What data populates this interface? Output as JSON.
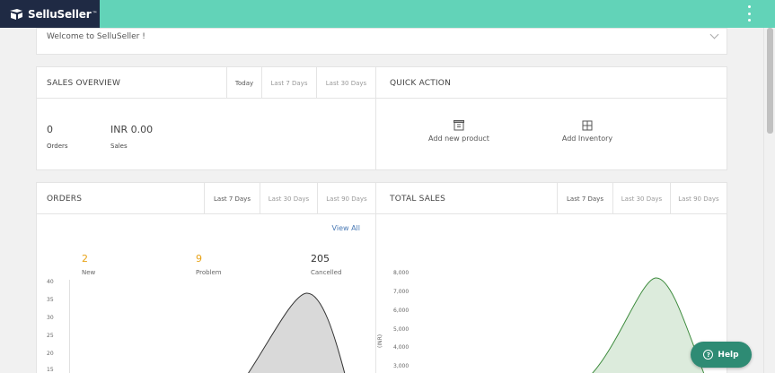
{
  "brand": {
    "name": "SelluSeller",
    "mark": "™"
  },
  "welcome": {
    "text": "Welcome to SelluSeller !"
  },
  "sales_overview": {
    "title": "SALES OVERVIEW",
    "tabs": [
      "Today",
      "Last 7 Days",
      "Last 30 Days"
    ],
    "active_tab": "Today",
    "orders": {
      "value": "0",
      "label": "Orders"
    },
    "sales": {
      "value": "INR 0.00",
      "label": "Sales"
    }
  },
  "quick_action": {
    "title": "QUICK ACTION",
    "items": [
      {
        "label": "Add new product",
        "icon": "product-box-icon"
      },
      {
        "label": "Add Inventory",
        "icon": "inventory-grid-icon"
      }
    ]
  },
  "orders": {
    "title": "ORDERS",
    "tabs": [
      "Last 7 Days",
      "Last 30 Days",
      "Last 90 Days"
    ],
    "active_tab": "Last 7 Days",
    "view_all": "View All",
    "stats": [
      {
        "value": "2",
        "label": "New",
        "color": "#e8a317"
      },
      {
        "value": "9",
        "label": "Problem",
        "color": "#e8a317"
      },
      {
        "value": "205",
        "label": "Cancelled",
        "color": "#333333"
      }
    ],
    "y_ticks": [
      "40",
      "35",
      "30",
      "25",
      "20",
      "15"
    ]
  },
  "total_sales": {
    "title": "TOTAL SALES",
    "tabs": [
      "Last 7 Days",
      "Last 30 Days",
      "Last 90 Days"
    ],
    "active_tab": "Last 7 Days",
    "y_axis_label": "(INR)",
    "y_ticks": [
      "8,000",
      "7,000",
      "6,000",
      "5,000",
      "4,000",
      "3,000"
    ]
  },
  "help": {
    "label": "Help"
  },
  "colors": {
    "topbar": "#62d3b8",
    "brand_bg": "#1f2a44",
    "sales_curve": "#3d8b3d",
    "orders_curve": "#d9d9d9",
    "help_bg": "#2e8b74"
  }
}
